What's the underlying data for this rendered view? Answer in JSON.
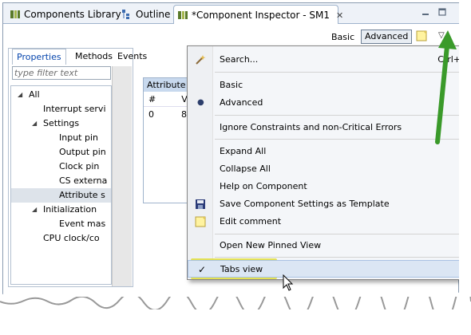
{
  "tabs": [
    {
      "label": "Components Library",
      "icon": "components-icon"
    },
    {
      "label": "Outline",
      "icon": "outline-icon"
    },
    {
      "label": "*Component Inspector - SM1",
      "icon": "inspector-icon",
      "close": "✕"
    }
  ],
  "toolbar": {
    "basic_label": "Basic",
    "advanced_label": "Advanced",
    "menu_glyph": "▽"
  },
  "left_panel": {
    "subtabs": [
      "Properties",
      "Methods",
      "Events"
    ],
    "filter_placeholder": "type filter text",
    "tree": [
      {
        "label": "All",
        "level": 0,
        "twisty": "◢"
      },
      {
        "label": "Interrupt servi",
        "level": 2
      },
      {
        "label": "Settings",
        "level": 1,
        "twisty": "◢"
      },
      {
        "label": "Input pin",
        "level": 3
      },
      {
        "label": "Output pin",
        "level": 3
      },
      {
        "label": "Clock pin",
        "level": 3
      },
      {
        "label": "CS externa",
        "level": 3
      },
      {
        "label": "Attribute s",
        "level": 3,
        "selected": true
      },
      {
        "label": "Initialization",
        "level": 1,
        "twisty": "◢"
      },
      {
        "label": "Event mas",
        "level": 3
      },
      {
        "label": "CPU clock/co",
        "level": 2
      }
    ]
  },
  "table": {
    "header": "Attribute",
    "columns": [
      "#",
      "V"
    ],
    "rows": [
      [
        "0",
        "8"
      ]
    ]
  },
  "menu": {
    "items": [
      {
        "label": "Search...",
        "accel": "Ctrl+",
        "icon": "search-wand-icon"
      },
      {
        "label": "Basic"
      },
      {
        "label": "Advanced",
        "radio": "●"
      },
      {
        "label": "Ignore Constraints and non-Critical Errors"
      },
      {
        "label": "Expand All"
      },
      {
        "label": "Collapse All"
      },
      {
        "label": "Help on Component"
      },
      {
        "label": "Save Component Settings as Template",
        "icon": "save-icon"
      },
      {
        "label": "Edit comment",
        "icon": "note-icon"
      },
      {
        "label": "Open New Pinned View"
      },
      {
        "label": "Tabs view",
        "check": "✓"
      }
    ]
  },
  "colors": {
    "accent_arrow": "#3a9a2a",
    "highlight": "#f7f39a",
    "selected_link": "#0645ad"
  }
}
